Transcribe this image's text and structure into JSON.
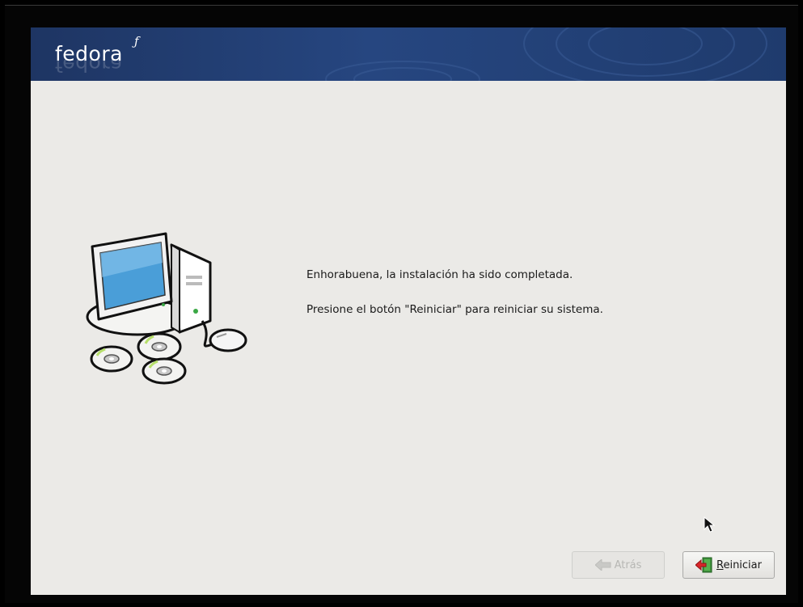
{
  "brand": {
    "logo_text": "fedora",
    "logo_mark": "ƒ"
  },
  "message": {
    "line1": "Enhorabuena, la instalación ha sido completada.",
    "line2": "Presione el botón \"Reiniciar\" para reiniciar su sistema."
  },
  "buttons": {
    "back": {
      "label": "Atrás",
      "enabled": false,
      "icon": "back-arrow-icon"
    },
    "reboot": {
      "label_first": "R",
      "label_rest": "einiciar",
      "icon": "reboot-exit-icon"
    }
  },
  "illustration": {
    "icon": "computer-with-discs-icon"
  },
  "colors": {
    "banner": "#264680",
    "background": "#ebeae7",
    "frame": "#000000"
  }
}
